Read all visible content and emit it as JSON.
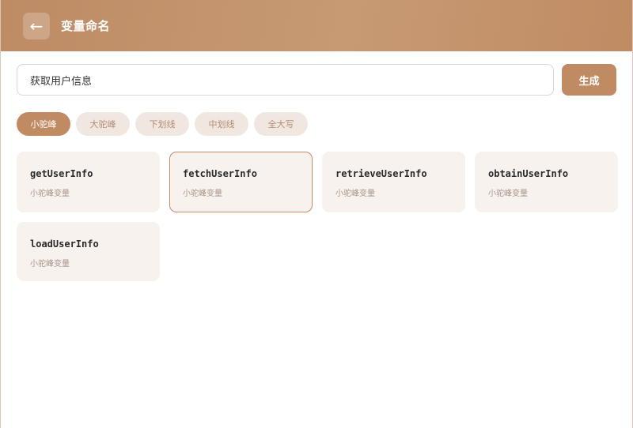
{
  "header": {
    "back_icon": "←",
    "title": "变量命名"
  },
  "input": {
    "value": "获取用户信息"
  },
  "generate_label": "生成",
  "tabs": [
    {
      "label": "小驼峰",
      "active": true
    },
    {
      "label": "大驼峰",
      "active": false
    },
    {
      "label": "下划线",
      "active": false
    },
    {
      "label": "中划线",
      "active": false
    },
    {
      "label": "全大写",
      "active": false
    }
  ],
  "results": [
    {
      "name": "getUserInfo",
      "type": "小驼峰变量"
    },
    {
      "name": "fetchUserInfo",
      "type": "小驼峰变量"
    },
    {
      "name": "retrieveUserInfo",
      "type": "小驼峰变量"
    },
    {
      "name": "obtainUserInfo",
      "type": "小驼峰变量"
    },
    {
      "name": "loadUserInfo",
      "type": "小驼峰变量"
    }
  ],
  "colors": {
    "accent": "#c08b63",
    "tab_bg": "#f1e7e1",
    "card_bg": "#f8f2ee",
    "selected_border": "#c58a66"
  }
}
